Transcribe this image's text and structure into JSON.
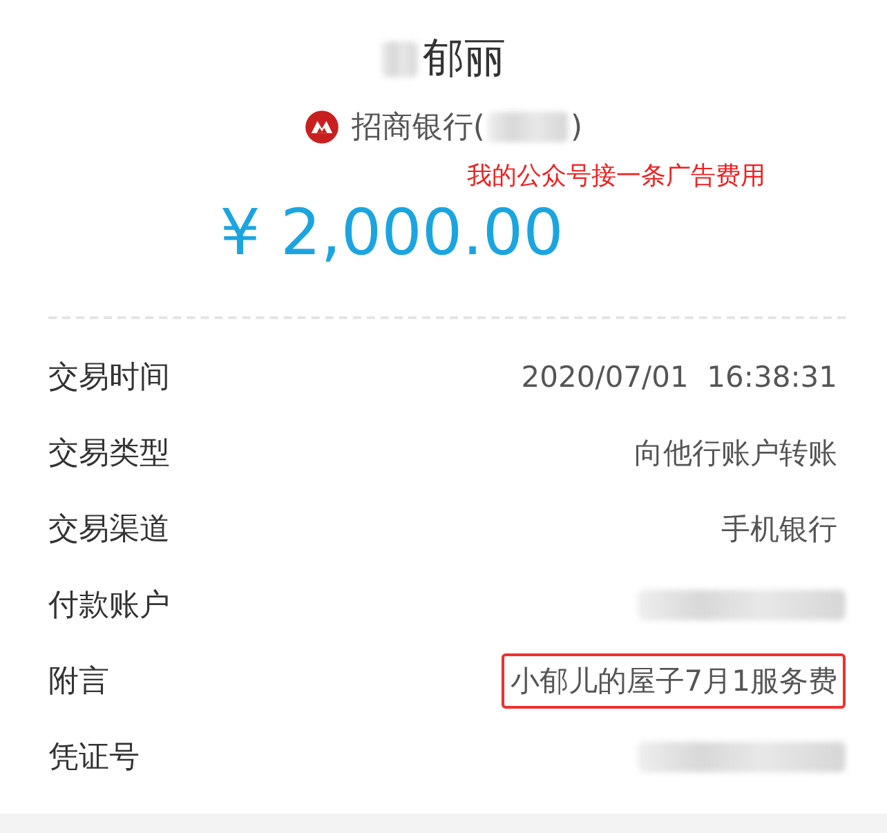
{
  "payee": {
    "name_redacted": true,
    "name": "郁丽"
  },
  "bank": {
    "name": "招商银行(",
    "close": ")",
    "account_redacted": true
  },
  "annotation": "我的公众号接一条广告费用",
  "amount": "¥ 2,000.00",
  "details": [
    {
      "label": "交易时间",
      "kind": "text",
      "value": "2020/07/01  16:38:31",
      "highlighted": false
    },
    {
      "label": "交易类型",
      "kind": "text",
      "value": "向他行账户转账",
      "highlighted": false
    },
    {
      "label": "交易渠道",
      "kind": "text",
      "value": "手机银行",
      "highlighted": false
    },
    {
      "label": "付款账户",
      "kind": "redacted",
      "highlighted": false
    },
    {
      "label": "附言",
      "kind": "text",
      "value": "小郁儿的屋子7月1服务费",
      "highlighted": true
    },
    {
      "label": "凭证号",
      "kind": "redacted",
      "highlighted": false
    }
  ]
}
